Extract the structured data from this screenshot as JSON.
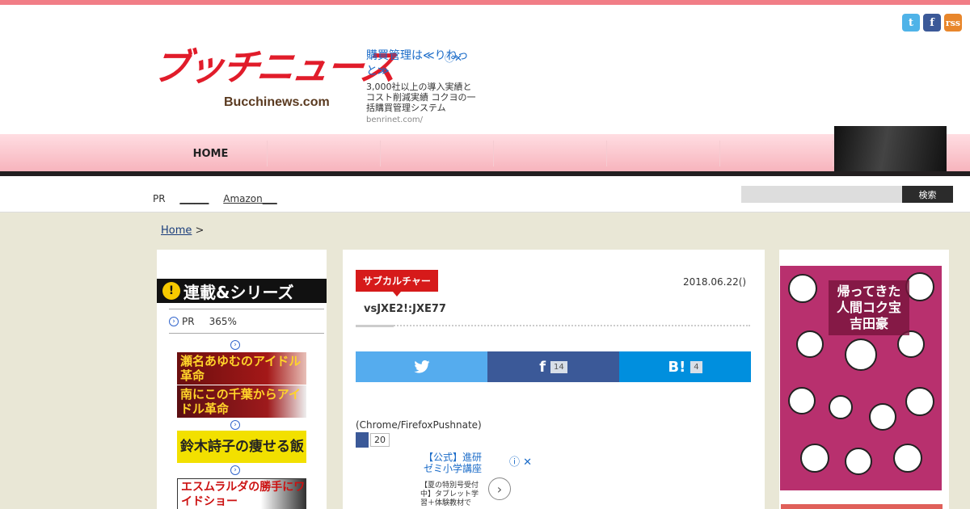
{
  "social": {
    "twitter": "t",
    "facebook": "f",
    "rss": "rss"
  },
  "logo": {
    "jp": "ブッチニュース",
    "en": "Bucchinews.com"
  },
  "header_ad": {
    "title": "購買管理は≪りねっと≫",
    "body": "3,000社以上の導入実績とコスト削減実績 コクヨの一括購買管理システム",
    "url": "benrinet.com/",
    "close": "ⓘ✕"
  },
  "nav": {
    "home": "HOME",
    "items": [
      "",
      "",
      "",
      "",
      ""
    ]
  },
  "subbar": {
    "pr": "PR",
    "link1": "______",
    "link2": "Amazon___"
  },
  "search": {
    "placeholder": "",
    "button": "検索"
  },
  "breadcrumb": {
    "home": "Home",
    "sep": ">"
  },
  "sidebar_left": {
    "series_title": "連載&シリーズ",
    "pr_label": "PR",
    "pr_value": "365%",
    "banners": [
      "瀬名あゆむのアイドル革命",
      "南にこの千葉からアイドル革命",
      "鈴木詩子の痩せる飯",
      "エスムラルダの勝手にワイドショー"
    ]
  },
  "article": {
    "category": "サブカルチャー",
    "date": "2018.06.22()",
    "title": "vsJXE2!:JXE77",
    "share": {
      "twitter": "",
      "facebook": "f",
      "facebook_count": "14",
      "hatena": "B!",
      "hatena_count": "4"
    },
    "push_text": "(Chrome/FirefoxPushnate)",
    "fb_count": "20"
  },
  "inline_ad": {
    "title": "【公式】進研ゼミ小学講座",
    "body": "【夏の特別号受付中】タブレット学習＋体験教材で",
    "close": "ⓘ ✕",
    "arrow": "›"
  },
  "sidebar_right": {
    "poster_title": "帰ってきた人間コク宝 吉田豪"
  },
  "colors": {
    "accent": "#f17d86",
    "category": "#d61a1a",
    "twitter": "#55acee",
    "facebook": "#3b5998",
    "hatena": "#008fde"
  }
}
